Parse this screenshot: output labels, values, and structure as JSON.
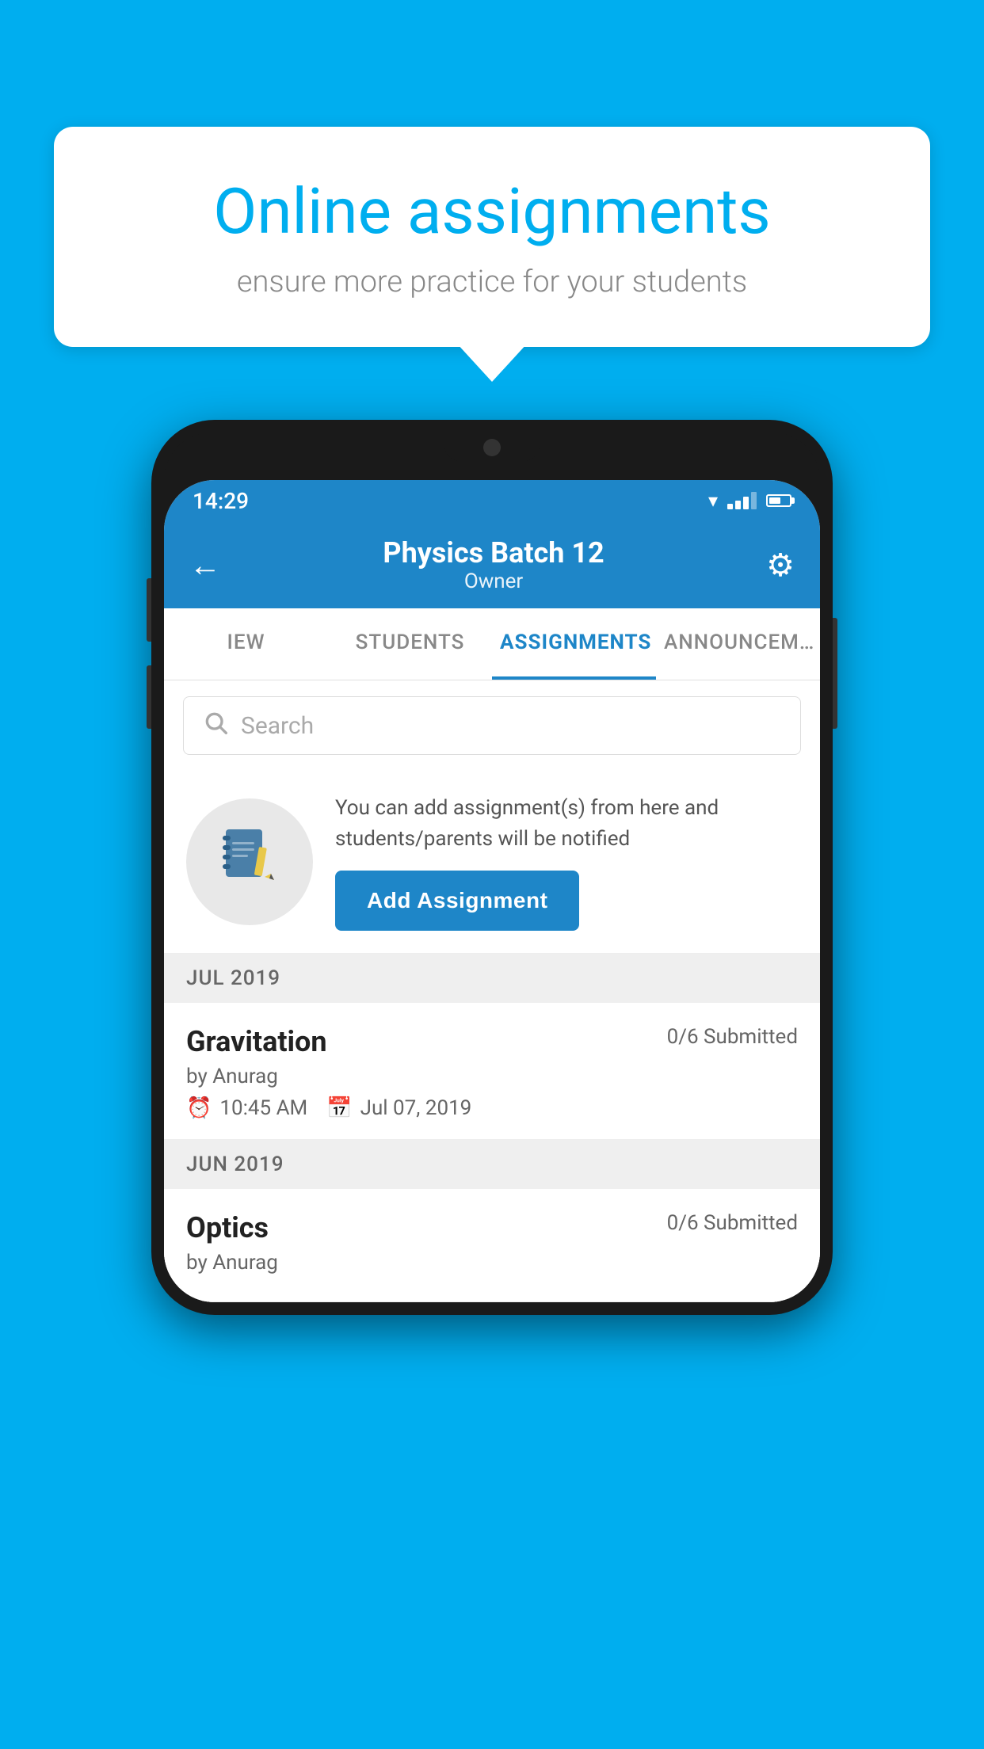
{
  "background_color": "#00AEEF",
  "speech_bubble": {
    "title": "Online assignments",
    "subtitle": "ensure more practice for your students"
  },
  "phone": {
    "status_bar": {
      "time": "14:29"
    },
    "header": {
      "title": "Physics Batch 12",
      "subtitle": "Owner",
      "back_label": "←",
      "settings_label": "⚙"
    },
    "tabs": [
      {
        "label": "IEW",
        "active": false
      },
      {
        "label": "STUDENTS",
        "active": false
      },
      {
        "label": "ASSIGNMENTS",
        "active": true
      },
      {
        "label": "ANNOUNCEM…",
        "active": false
      }
    ],
    "search": {
      "placeholder": "Search"
    },
    "promo": {
      "text": "You can add assignment(s) from here and students/parents will be notified",
      "button_label": "Add Assignment"
    },
    "assignment_sections": [
      {
        "month": "JUL 2019",
        "assignments": [
          {
            "name": "Gravitation",
            "submitted": "0/6 Submitted",
            "by": "by Anurag",
            "time": "10:45 AM",
            "date": "Jul 07, 2019"
          }
        ]
      },
      {
        "month": "JUN 2019",
        "assignments": [
          {
            "name": "Optics",
            "submitted": "0/6 Submitted",
            "by": "by Anurag",
            "time": "",
            "date": ""
          }
        ]
      }
    ]
  }
}
